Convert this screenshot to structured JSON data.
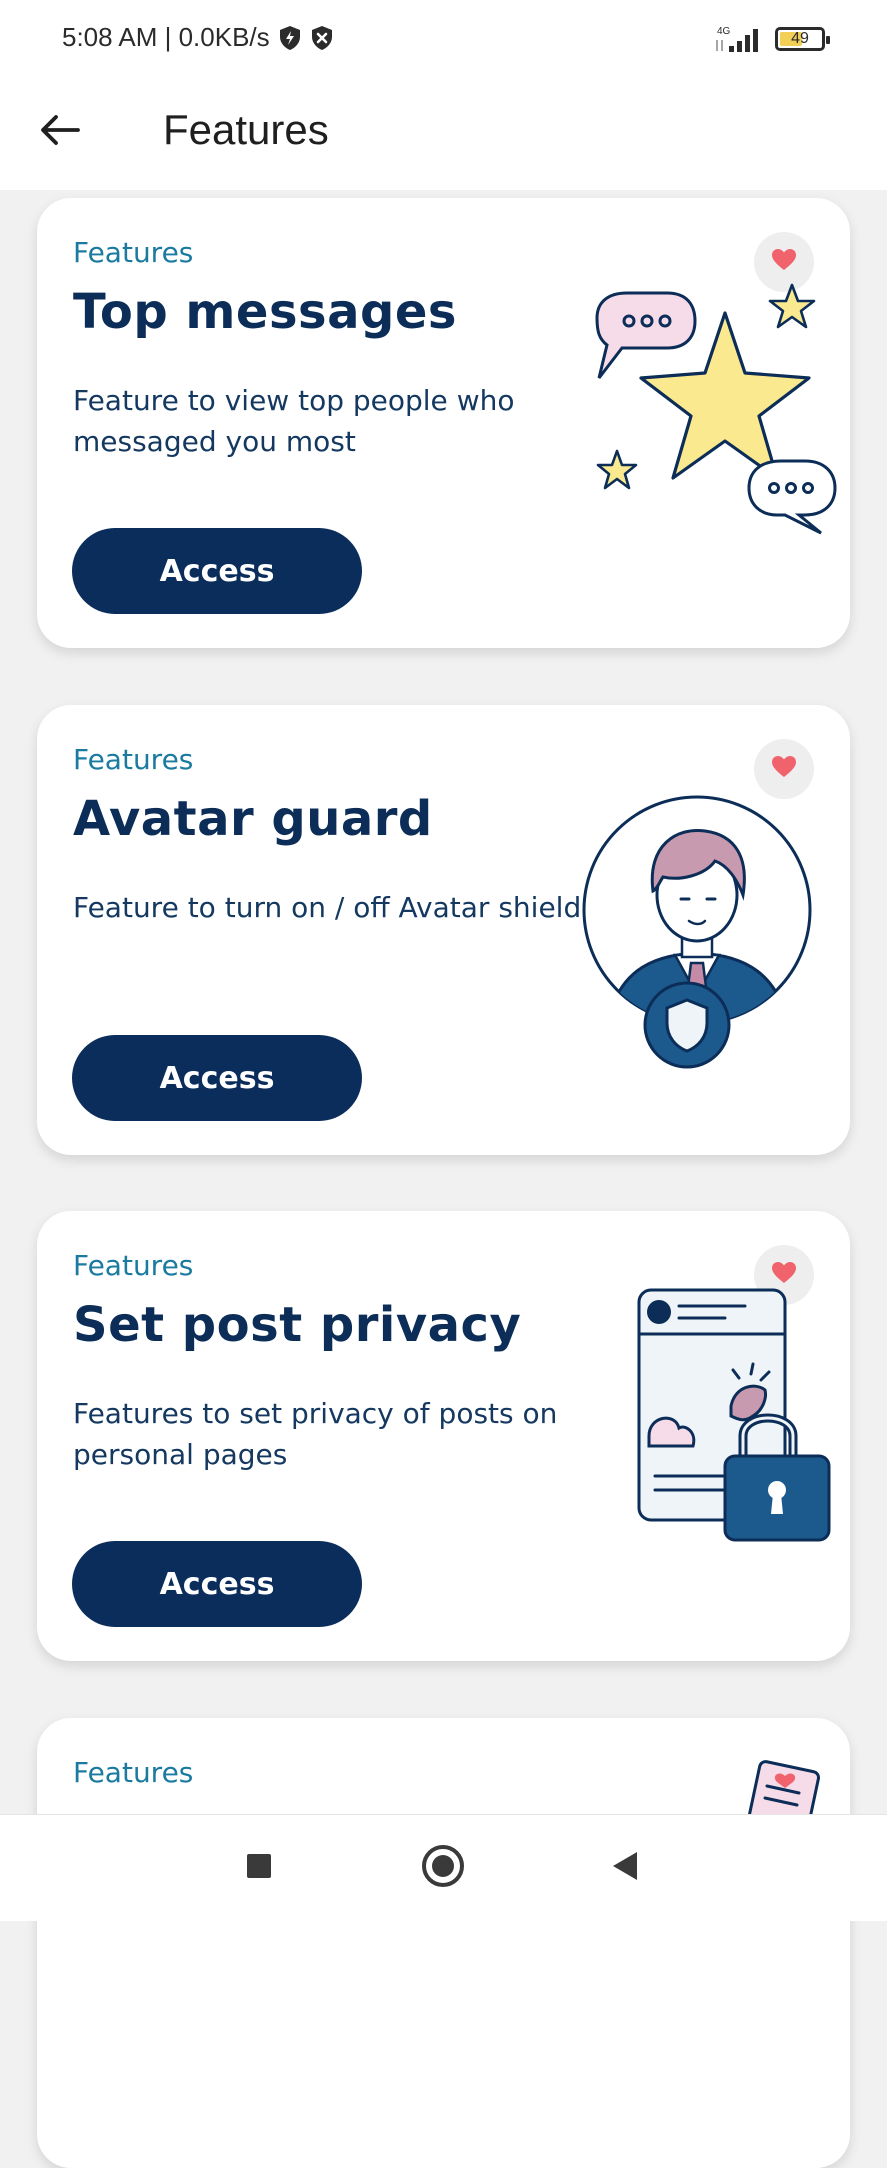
{
  "status_bar": {
    "time_speed": "5:08 AM | 0.0KB/s",
    "network": "4G",
    "battery": "49",
    "icons": [
      "lightning-shield-icon",
      "blocked-shield-icon",
      "signal-icon",
      "battery-icon"
    ]
  },
  "app_bar": {
    "title": "Features",
    "back_icon": "arrow-left-icon"
  },
  "cards": [
    {
      "tag": "Features",
      "title": "Top messages",
      "description": "Feature to view top people who messaged you most",
      "button_label": "Access",
      "illustration": "star-chat-bubbles-icon"
    },
    {
      "tag": "Features",
      "title": "Avatar guard",
      "description": "Feature to turn on / off Avatar shield",
      "button_label": "Access",
      "illustration": "avatar-shield-icon"
    },
    {
      "tag": "Features",
      "title": "Set post privacy",
      "description": "Features to set privacy of posts on personal pages",
      "button_label": "Access",
      "illustration": "phone-padlock-icon"
    },
    {
      "tag": "Features"
    }
  ],
  "nav_bar": {
    "icons": [
      "square-recents-icon",
      "circle-home-icon",
      "triangle-back-icon"
    ]
  },
  "colors": {
    "primary": "#0b2d5b",
    "accent_text": "#1a7aa0",
    "heart": "#f0636d",
    "background": "#f1f1f1"
  }
}
